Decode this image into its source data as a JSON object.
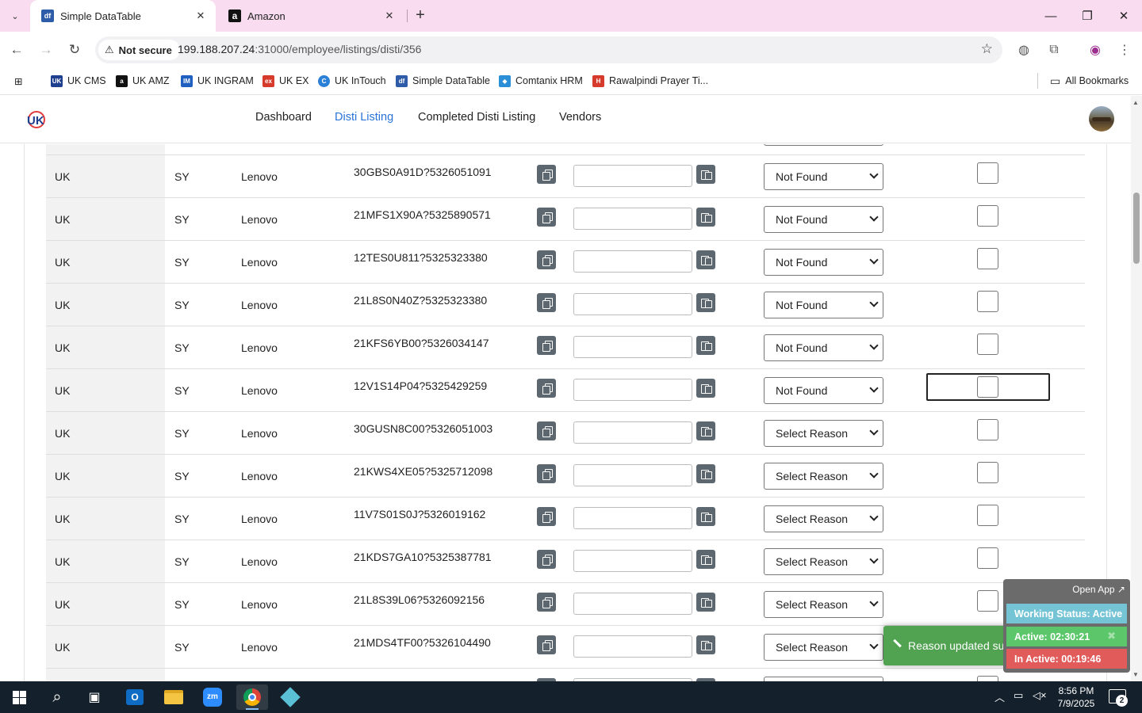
{
  "browser": {
    "tabs": [
      {
        "title": "Simple DataTable",
        "favicon": "df",
        "active": true
      },
      {
        "title": "Amazon",
        "favicon": "a",
        "active": false
      }
    ],
    "security_label": "Not secure",
    "url_host": "199.188.207.24",
    "url_path": ":31000/employee/listings/disti/356",
    "bookmarks": [
      {
        "label": "UK CMS",
        "icon": "UK",
        "color": "#1f3f8f"
      },
      {
        "label": "UK AMZ",
        "icon": "a",
        "color": "#111111"
      },
      {
        "label": "UK INGRAM",
        "icon": "IM",
        "color": "#1e5fbf"
      },
      {
        "label": "UK EX",
        "icon": "ex",
        "color": "#d63a2b"
      },
      {
        "label": "UK InTouch",
        "icon": "C",
        "color": "#2a7fd6"
      },
      {
        "label": "Simple DataTable",
        "icon": "df",
        "color": "#2f5ca8"
      },
      {
        "label": "Comtanix HRM",
        "icon": "◆",
        "color": "#2a8fd6"
      },
      {
        "label": "Rawalpindi Prayer Ti...",
        "icon": "H",
        "color": "#d63a2b"
      }
    ],
    "all_bookmarks": "All Bookmarks"
  },
  "app": {
    "nav": [
      "Dashboard",
      "Disti Listing",
      "Completed Disti Listing",
      "Vendors"
    ],
    "active_nav": "Disti Listing"
  },
  "rows": [
    {
      "country": "UK",
      "code": "SY",
      "brand": "Lenovo",
      "part": "30GBS0A91D?5326051091",
      "reason": "Not Found"
    },
    {
      "country": "UK",
      "code": "SY",
      "brand": "Lenovo",
      "part": "21MFS1X90A?5325890571",
      "reason": "Not Found"
    },
    {
      "country": "UK",
      "code": "SY",
      "brand": "Lenovo",
      "part": "12TES0U811?5325323380",
      "reason": "Not Found"
    },
    {
      "country": "UK",
      "code": "SY",
      "brand": "Lenovo",
      "part": "21L8S0N40Z?5325323380",
      "reason": "Not Found"
    },
    {
      "country": "UK",
      "code": "SY",
      "brand": "Lenovo",
      "part": "21KFS6YB00?5326034147",
      "reason": "Not Found"
    },
    {
      "country": "UK",
      "code": "SY",
      "brand": "Lenovo",
      "part": "12V1S14P04?5325429259",
      "reason": "Not Found"
    },
    {
      "country": "UK",
      "code": "SY",
      "brand": "Lenovo",
      "part": "30GUSN8C00?5326051003",
      "reason": "Select Reason"
    },
    {
      "country": "UK",
      "code": "SY",
      "brand": "Lenovo",
      "part": "21KWS4XE05?5325712098",
      "reason": "Select Reason"
    },
    {
      "country": "UK",
      "code": "SY",
      "brand": "Lenovo",
      "part": "11V7S01S0J?5326019162",
      "reason": "Select Reason"
    },
    {
      "country": "UK",
      "code": "SY",
      "brand": "Lenovo",
      "part": "21KDS7GA10?5325387781",
      "reason": "Select Reason"
    },
    {
      "country": "UK",
      "code": "SY",
      "brand": "Lenovo",
      "part": "21L8S39L06?5326092156",
      "reason": "Select Reason"
    },
    {
      "country": "UK",
      "code": "SY",
      "brand": "Lenovo",
      "part": "21MDS4TF00?5326104490",
      "reason": "Select Reason"
    }
  ],
  "focused_row_index": 5,
  "toast": {
    "message": "Reason updated successfully",
    "color": "#51a351"
  },
  "widget": {
    "open_app": "Open App ↗",
    "status": "Working Status: Active",
    "active": "Active: 02:30:21",
    "inactive": "In Active: 00:19:46"
  },
  "taskbar": {
    "time": "8:56 PM",
    "date": "7/9/2025",
    "notification_count": "2",
    "apps": [
      "start",
      "search",
      "task-view",
      "outlook",
      "file-explorer",
      "zoom",
      "chrome",
      "app"
    ]
  }
}
